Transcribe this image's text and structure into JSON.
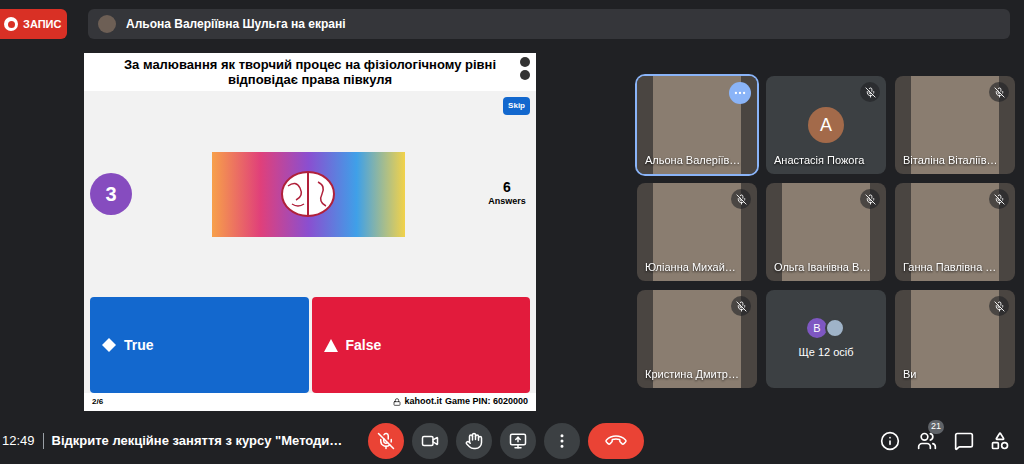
{
  "recording": {
    "label": "ЗАПИС",
    "on": true
  },
  "presenter_banner": {
    "text": "Альона Валеріївна Шульга на екрані"
  },
  "slide": {
    "question": "За малювання як творчий процес на фізіологічному рівні відповідає права півкуля",
    "skip": "Skip",
    "timer": "3",
    "answers_count": "6",
    "answers_label": "Answers",
    "options": [
      {
        "label": "True",
        "shape": "diamond",
        "color": "#1368ce"
      },
      {
        "label": "False",
        "shape": "triangle",
        "color": "#e21b3c"
      }
    ],
    "progress": "2/6",
    "site": "kahoot.it",
    "pin": "Game PIN: 6020000"
  },
  "participants": [
    {
      "name": "Альона Валеріїв…",
      "kind": "video",
      "muted": false,
      "speaking": true
    },
    {
      "name": "Анастасія Пожога",
      "kind": "avatar",
      "initial": "А",
      "color": "#a36a4a",
      "muted": true,
      "speaking": false
    },
    {
      "name": "Віталіна Віталіїв…",
      "kind": "video",
      "muted": true,
      "speaking": false
    },
    {
      "name": "Юліанна Михай…",
      "kind": "video",
      "muted": true,
      "speaking": false
    },
    {
      "name": "Ольга Іванівна В…",
      "kind": "video",
      "muted": true,
      "speaking": false
    },
    {
      "name": "Ганна Павлівна …",
      "kind": "video",
      "muted": true,
      "speaking": false
    },
    {
      "name": "Кристина Дмитр…",
      "kind": "video",
      "muted": true,
      "speaking": false
    },
    {
      "name": "Ще 12 осіб",
      "kind": "overflow",
      "initial": "В",
      "color": "#7e57c2",
      "muted": false,
      "speaking": false
    },
    {
      "name": "Ви",
      "kind": "video",
      "muted": true,
      "speaking": false
    }
  ],
  "bottom_bar": {
    "time": "12:49",
    "meeting": "Відкрите лекційне заняття з курсу \"Методи…",
    "mic_muted": true,
    "people_count": "21"
  }
}
